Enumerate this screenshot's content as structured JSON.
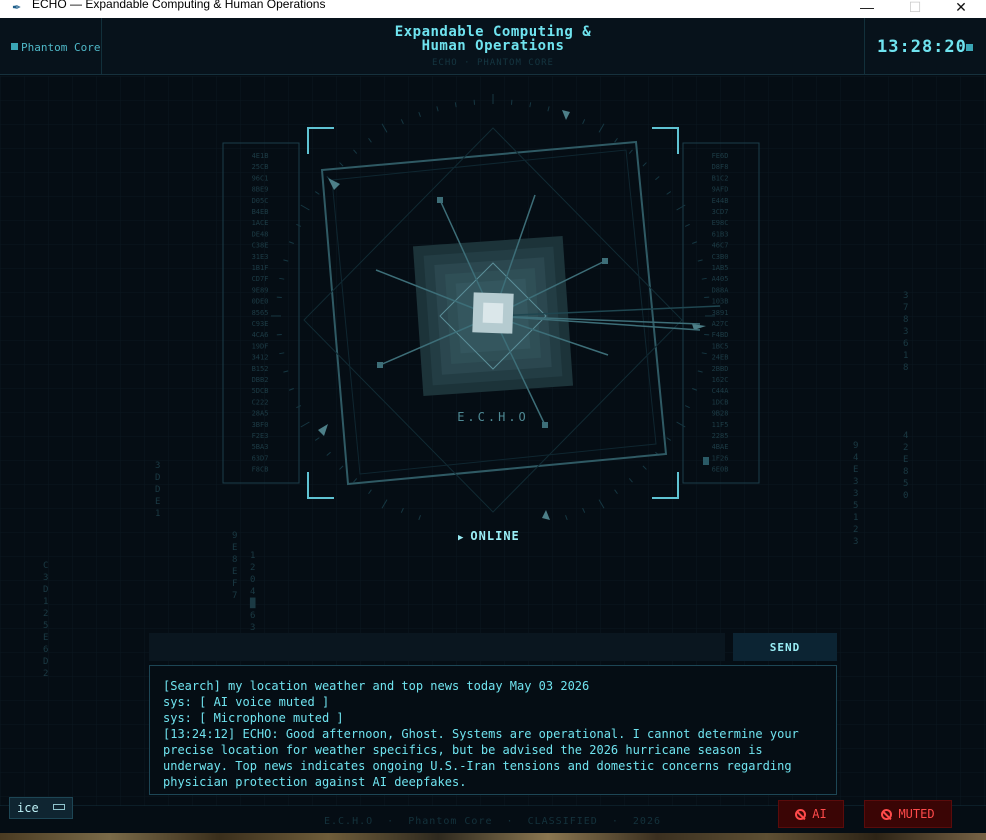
{
  "window": {
    "title": "ECHO — Expandable Computing & Human Operations",
    "minimize": "—",
    "maximize": "☐",
    "close": "✕"
  },
  "header": {
    "brand": "Phantom Core",
    "title_line1": "Expandable Computing &",
    "title_line2": "Human Operations",
    "subtitle": "ECHO  ·  PHANTOM CORE",
    "clock": "13:28:20"
  },
  "core": {
    "label": "E.C.H.O",
    "status": "ONLINE"
  },
  "command": {
    "input_value": "",
    "input_placeholder": "",
    "send_label": "SEND"
  },
  "log": [
    "[Search] my location weather and top news today May 03 2026",
    "sys: [ AI voice muted ]",
    "sys: [ Microphone muted ]",
    "[13:24:12] ECHO: Good afternoon, Ghost. Systems are operational. I cannot determine your precise location for weather specifics, but be advised the 2026 hurricane season is underway. Top news indicates ongoing U.S.-Iran tensions and domestic concerns regarding physician protection against AI deepfakes."
  ],
  "footer": {
    "user": "ice",
    "text": "E.C.H.O  ·  Phantom Core  ·  CLASSIFIED  ·  2026",
    "ai_label": "AI",
    "muted_label": "MUTED"
  },
  "colors": {
    "accent": "#6fe3ef",
    "background": "#050d14",
    "alert": "#ff4a4a"
  },
  "hex_left": [
    "4E1B",
    "25CB",
    "96C1",
    "8BE9",
    "D05C",
    "B4EB",
    "1ACE",
    "DE48",
    "C38E",
    "31E3",
    "1B1F",
    "CD7F",
    "9E89",
    "0DE0",
    "8565",
    "C93E",
    "4CA6",
    "19DF",
    "3412",
    "B152",
    "DBB2",
    "5DCB",
    "C222",
    "28A5",
    "3BF0",
    "F2E3",
    "5BA3",
    "63D7",
    "F8CB"
  ],
  "hex_right": [
    "FE6D",
    "D8F8",
    "B1C2",
    "9AFD",
    "E44B",
    "3CD7",
    "E98C",
    "61B3",
    "46C7",
    "C3B0",
    "1AB5",
    "A405",
    "D88A",
    "103B",
    "3891",
    "A27C",
    "F4BD",
    "1BC5",
    "24EB",
    "2BBD",
    "162C",
    "C44A",
    "1DCB",
    "9B28",
    "11F5",
    "2285",
    "4BAE",
    "1F26",
    "6E0B"
  ]
}
